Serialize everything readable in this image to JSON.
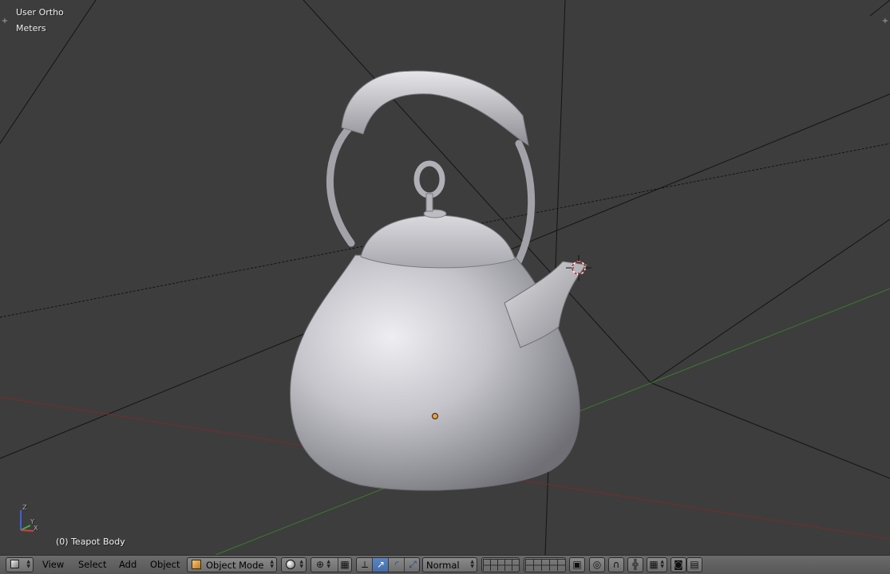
{
  "viewport": {
    "view_label": "User Ortho",
    "units_label": "Meters",
    "object_label": "(0) Teapot Body",
    "axis_labels": {
      "z": "Z",
      "y": "Y",
      "x": "X"
    }
  },
  "header": {
    "editor_type_icon": "cube-icon",
    "menus": {
      "view": "View",
      "select": "Select",
      "add": "Add",
      "object": "Object"
    },
    "mode": {
      "icon": "object-mode-cube-icon",
      "label": "Object Mode"
    },
    "shading_icon": "solid-sphere-icon",
    "pivot_icon": "pivot-point-icon",
    "manipulator_icons": [
      "manipulator-toggle-icon",
      "translate-arrow-icon",
      "rotate-arc-icon",
      "scale-icon"
    ],
    "orientation": {
      "label": "Normal"
    },
    "layers": {
      "rows": 2,
      "cols": 10
    },
    "tool_icons": [
      "lock-icon",
      "proportional-edit-icon",
      "magnet-snap-icon",
      "snap-target-icon",
      "snap-align-icon",
      "render-icon",
      "clapper-icon"
    ]
  },
  "colors": {
    "viewport_bg": "#3d3d3d",
    "header_bg": "#656565",
    "x_axis": "#8c2b2b",
    "y_axis": "#3c8a2e",
    "active_blue": "#5680c2",
    "teapot": "#c8c8ce"
  }
}
